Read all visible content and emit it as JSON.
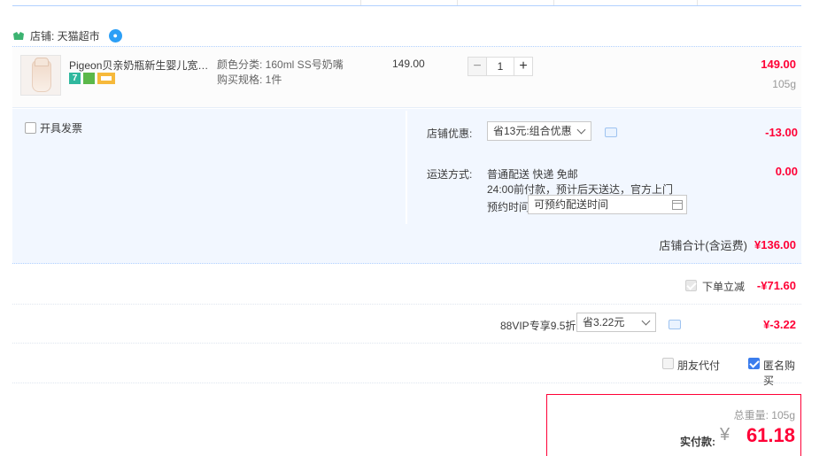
{
  "store": {
    "label": "店铺: 天猫超市"
  },
  "item": {
    "title": "Pigeon贝亲奶瓶新生婴儿宽口径玻璃奶瓶",
    "sku_color": "颜色分类: 160ml SS号奶嘴",
    "sku_spec": "购买规格: 1件",
    "unit_price": "149.00",
    "quantity": "1",
    "minus": "−",
    "plus": "+",
    "subtotal": "149.00",
    "weight": "105g",
    "badge_7": "7"
  },
  "invoice": {
    "label": "开具发票"
  },
  "discount": {
    "label": "店铺优惠:",
    "selected": "省13元:组合优惠",
    "amount": "-13.00"
  },
  "shipping": {
    "label": "运送方式:",
    "method": "普通配送 快递 免邮",
    "detail": "24:00前付款，预计后天送达，官方上门",
    "appt_label": "预约时间",
    "appt_placeholder": "可预约配送时间",
    "amount": "0.00"
  },
  "store_total": {
    "label": "店铺合计(含运费)",
    "amount": "¥136.00"
  },
  "instant_discount": {
    "label": "下单立减",
    "amount": "-¥71.60"
  },
  "vip": {
    "label": "88VIP专享9.5折",
    "selected": "省3.22元",
    "amount": "¥-3.22"
  },
  "options": {
    "friend_pay": "朋友代付",
    "anonymous": "匿名购买"
  },
  "summary": {
    "weight_label": "总重量:",
    "weight": "105g",
    "pay_label": "实付款:",
    "currency": "¥",
    "pay_amount": "61.18"
  },
  "colors": {
    "accent_red": "#ff0036",
    "panel_bg": "#f2f7ff",
    "checkbox_blue": "#3b7ded"
  }
}
